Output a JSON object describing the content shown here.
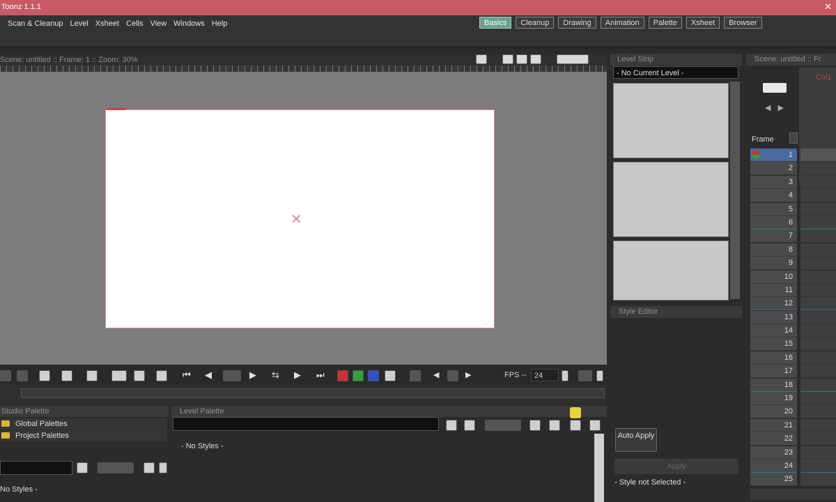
{
  "app": {
    "title": "Toonz 1.1.1",
    "close": "✕"
  },
  "menu": [
    "Scan & Cleanup",
    "Level",
    "Xsheet",
    "Cells",
    "View",
    "Windows",
    "Help"
  ],
  "rooms": [
    {
      "label": "Basics",
      "active": true
    },
    {
      "label": "Cleanup"
    },
    {
      "label": "Drawing"
    },
    {
      "label": "Animation"
    },
    {
      "label": "Palette"
    },
    {
      "label": "Xsheet"
    },
    {
      "label": "Browser"
    }
  ],
  "viewer": {
    "header": "Scene: untitled  ::  Frame: 1  ::  Zoom: 30%",
    "canvas_mark": "✕"
  },
  "playback": {
    "fps_label": "FPS --",
    "fps_value": "24"
  },
  "studio_palette": {
    "title": "Studio Palette",
    "items": [
      "Global Palettes",
      "Project Palettes"
    ],
    "empty": "No Styles -"
  },
  "level_palette": {
    "title": "Level Palette",
    "empty": "- No Styles -"
  },
  "level_strip": {
    "title": "Level Strip",
    "current": "- No Current Level -"
  },
  "style_editor": {
    "title": "Style Editor",
    "auto_apply": "Auto Apply",
    "apply": "Apply",
    "status": "- Style not Selected -"
  },
  "xsheet": {
    "title": "Scene: untitled  ::  Fr",
    "column": "Col1",
    "frame_label": "Frame",
    "current_frame": 1,
    "frames": [
      "1",
      "2",
      "3",
      "4",
      "5",
      "6",
      "7",
      "8",
      "9",
      "10",
      "11",
      "12",
      "13",
      "14",
      "15",
      "16",
      "17",
      "18",
      "19",
      "20",
      "21",
      "22",
      "23",
      "24",
      "25"
    ]
  },
  "icons": {
    "title_close": "close-icon",
    "folder": "folder-icon",
    "bulb": "lightbulb-icon"
  }
}
